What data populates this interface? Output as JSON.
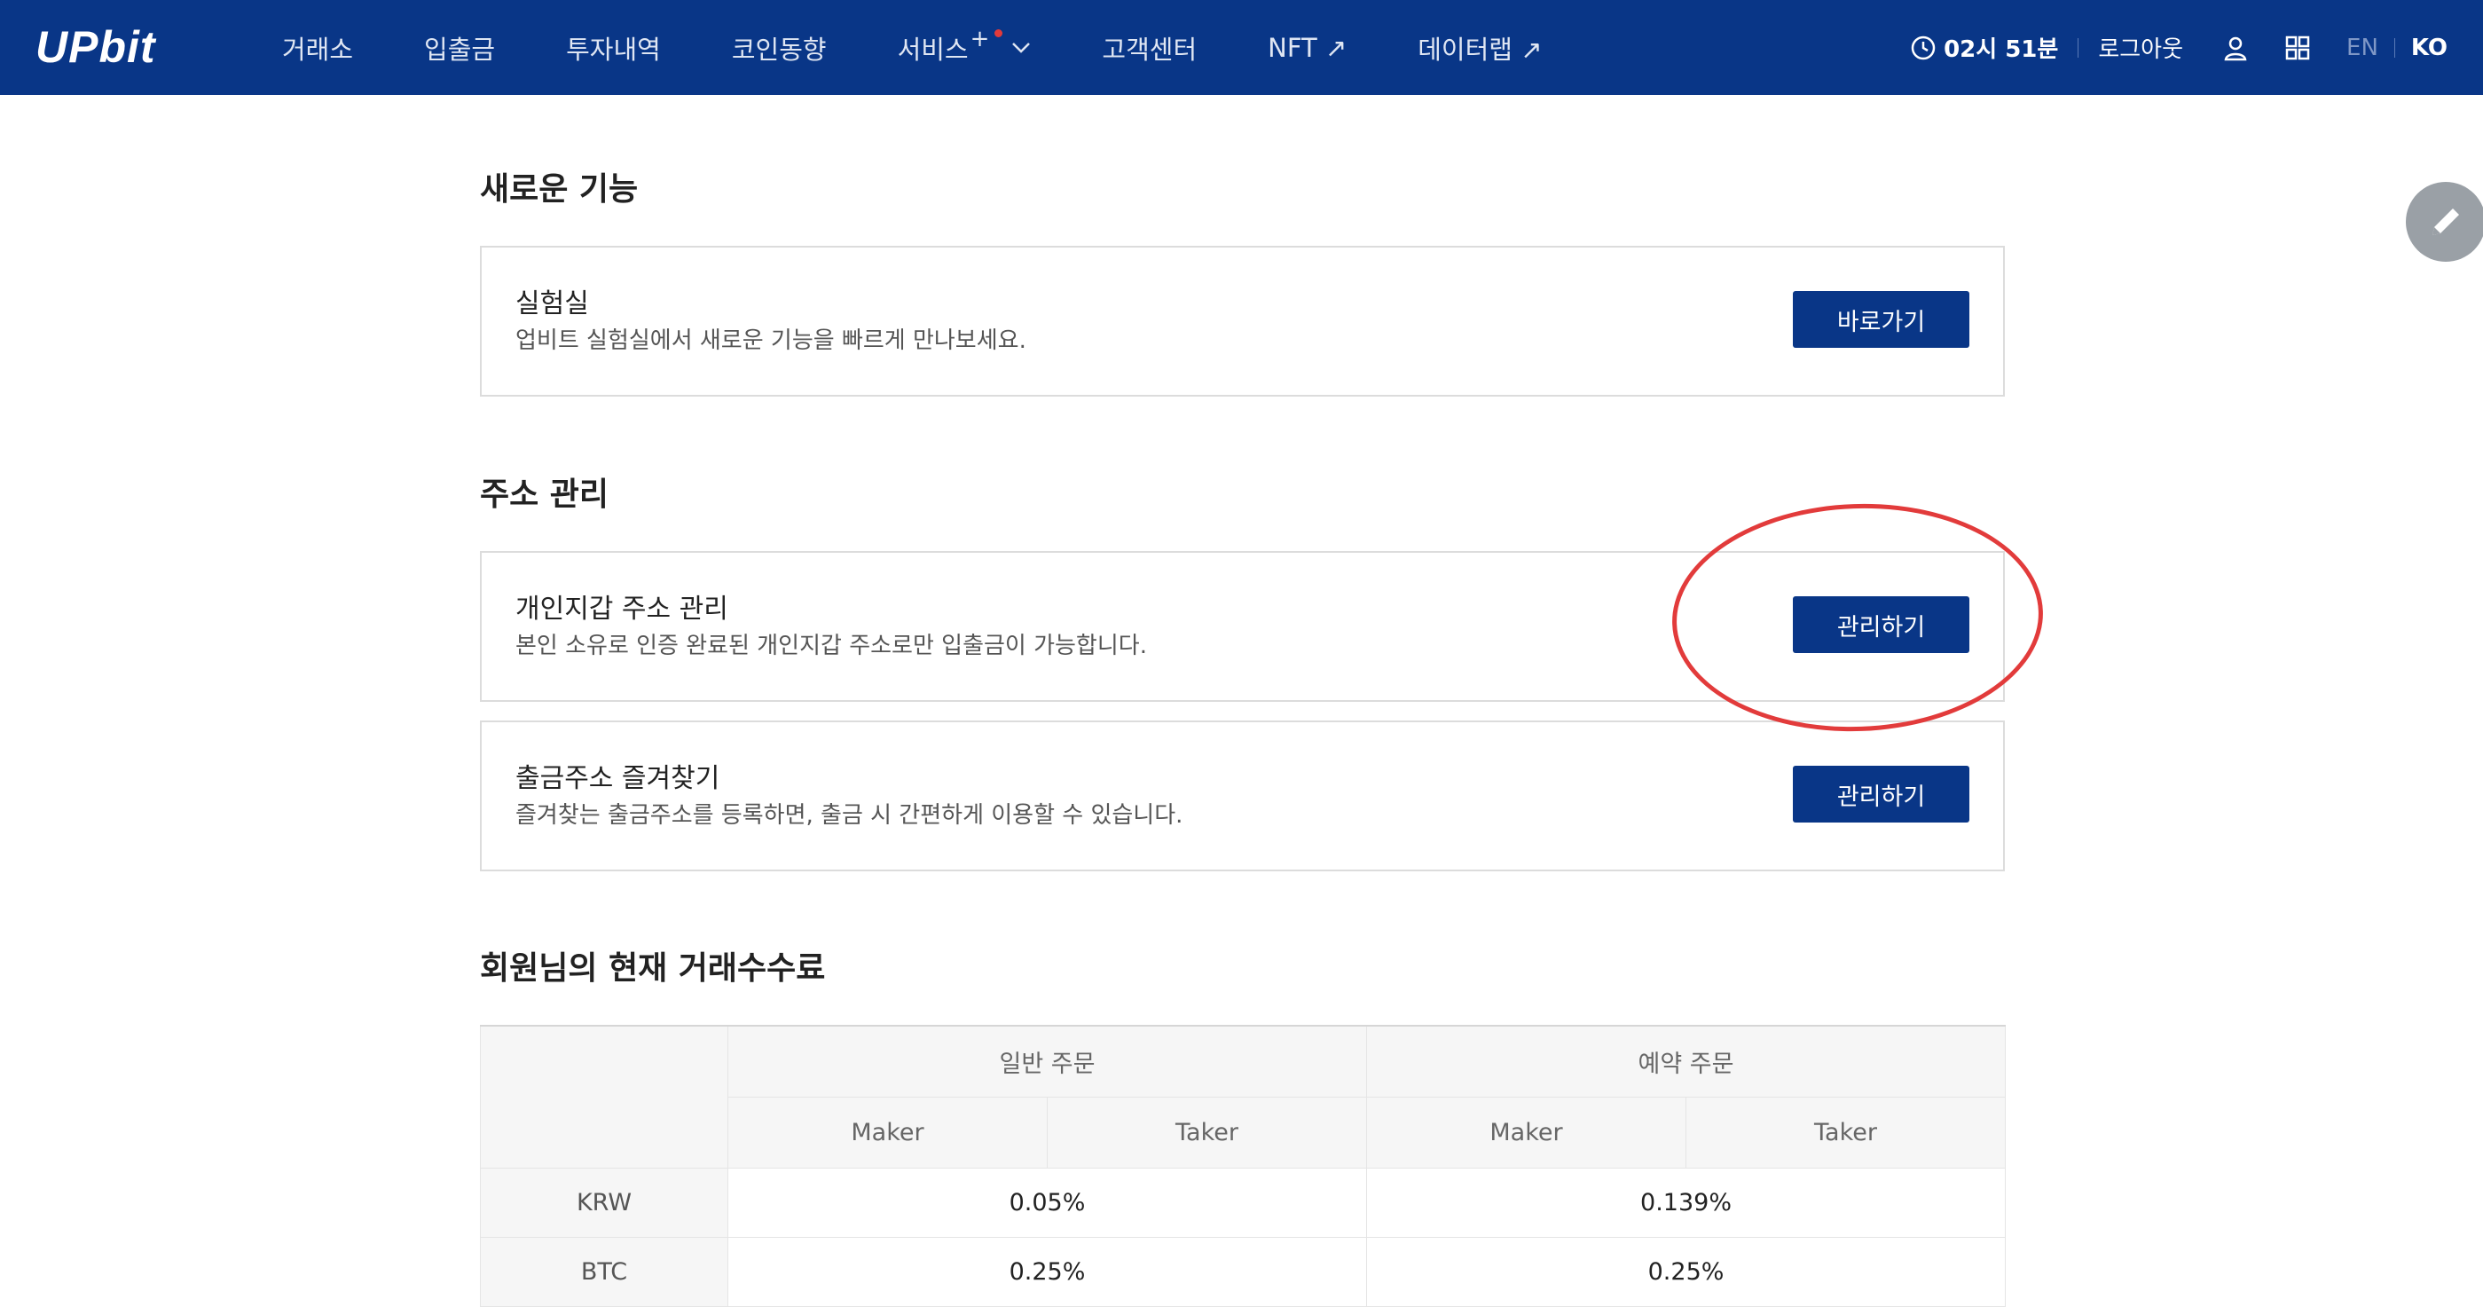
{
  "header": {
    "logo": "UPbit",
    "nav": [
      {
        "label": "거래소"
      },
      {
        "label": "입출금"
      },
      {
        "label": "투자내역"
      },
      {
        "label": "코인동향"
      },
      {
        "label": "서비스",
        "suffix": "+"
      },
      {
        "label": "고객센터"
      },
      {
        "label": "NFT ↗"
      },
      {
        "label": "데이터랩 ↗"
      }
    ],
    "time": "02시 51분",
    "logout": "로그아웃",
    "lang_en": "EN",
    "lang_ko": "KO"
  },
  "sections": {
    "new_features": {
      "title": "새로운 기능",
      "cards": [
        {
          "title": "실험실",
          "desc": "업비트 실험실에서 새로운 기능을 빠르게 만나보세요.",
          "button": "바로가기"
        }
      ]
    },
    "address": {
      "title": "주소 관리",
      "cards": [
        {
          "title": "개인지갑 주소 관리",
          "desc": "본인 소유로 인증 완료된 개인지갑 주소로만 입출금이 가능합니다.",
          "button": "관리하기"
        },
        {
          "title": "출금주소 즐겨찾기",
          "desc": "즐겨찾는 출금주소를 등록하면, 출금 시 간편하게 이용할 수 있습니다.",
          "button": "관리하기"
        }
      ]
    },
    "fees": {
      "title": "회원님의 현재 거래수수료",
      "group_headers": [
        "일반 주문",
        "예약 주문"
      ],
      "sub_headers": [
        "Maker",
        "Taker",
        "Maker",
        "Taker"
      ],
      "rows": [
        {
          "market": "KRW",
          "normal": "0.05%",
          "reserved": "0.139%"
        },
        {
          "market": "BTC",
          "normal": "0.25%",
          "reserved": "0.25%"
        }
      ]
    }
  },
  "colors": {
    "brand": "#093687",
    "highlight": "#e23b3b"
  }
}
